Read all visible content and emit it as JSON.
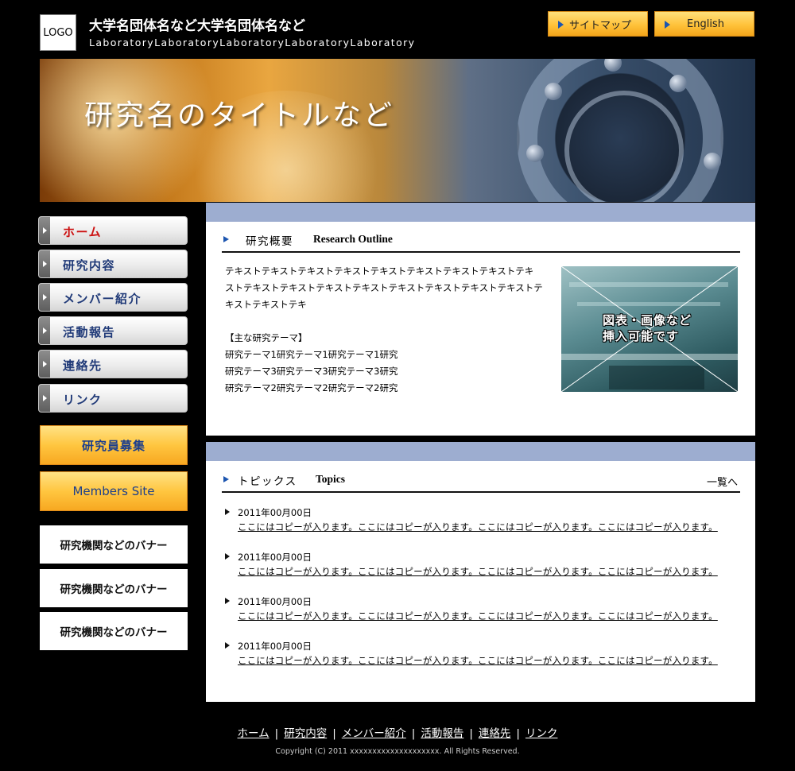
{
  "header": {
    "logo_text": "LOGO",
    "org_name": "大学名団体名など大学名団体名など",
    "org_subtitle": "LaboratoryLaboratoryLaboratoryLaboratoryLaboratory",
    "buttons": [
      {
        "label": "サイトマップ"
      },
      {
        "label": "English"
      }
    ]
  },
  "hero": {
    "title": "研究名のタイトルなど"
  },
  "sidebar": {
    "nav": [
      {
        "label": "ホーム",
        "active": true
      },
      {
        "label": "研究内容"
      },
      {
        "label": "メンバー紹介"
      },
      {
        "label": "活動報告"
      },
      {
        "label": "連絡先"
      },
      {
        "label": "リンク"
      }
    ],
    "recruit_label": "研究員募集",
    "members_label": "Members Site",
    "banners": [
      "研究機関などのバナー",
      "研究機関などのバナー",
      "研究機関などのバナー"
    ]
  },
  "outline": {
    "heading_jp": "研究概要",
    "heading_en": "Research Outline",
    "text_lines": [
      "テキストテキストテキストテキストテキストテキストテキストテキストテキ",
      "ストテキストテキストテキストテキストテキストテキストテキストテキストテ",
      "キストテキストテキ"
    ],
    "themes_heading": "【主な研究テーマ】",
    "themes": [
      "研究テーマ1研究テーマ1研究テーマ1研究",
      "研究テーマ3研究テーマ3研究テーマ3研究",
      "研究テーマ2研究テーマ2研究テーマ2研究"
    ],
    "figure_caption_1": "図表・画像など",
    "figure_caption_2": "挿入可能です"
  },
  "topics": {
    "heading_jp": "トピックス",
    "heading_en": "Topics",
    "more_label": "一覧へ",
    "items": [
      {
        "date": "2011年00月00日",
        "text": "ここにはコピーが入ります。ここにはコピーが入ります。ここにはコピーが入ります。ここにはコピーが入ります。"
      },
      {
        "date": "2011年00月00日",
        "text": "ここにはコピーが入ります。ここにはコピーが入ります。ここにはコピーが入ります。ここにはコピーが入ります。"
      },
      {
        "date": "2011年00月00日",
        "text": "ここにはコピーが入ります。ここにはコピーが入ります。ここにはコピーが入ります。ここにはコピーが入ります。"
      },
      {
        "date": "2011年00月00日",
        "text": "ここにはコピーが入ります。ここにはコピーが入ります。ここにはコピーが入ります。ここにはコピーが入ります。"
      }
    ]
  },
  "footer": {
    "links": [
      "ホーム",
      "研究内容",
      "メンバー紹介",
      "活動報告",
      "連絡先",
      "リンク"
    ],
    "separator": "|",
    "copyright": "Copyright (C) 2011 xxxxxxxxxxxxxxxxxxxx. All Rights Reserved."
  },
  "colors": {
    "background": "#000000",
    "accent_orange": "#ffc23a",
    "section_bar": "#9dadd0",
    "nav_text": "#203a78",
    "nav_active": "#cc1111"
  }
}
